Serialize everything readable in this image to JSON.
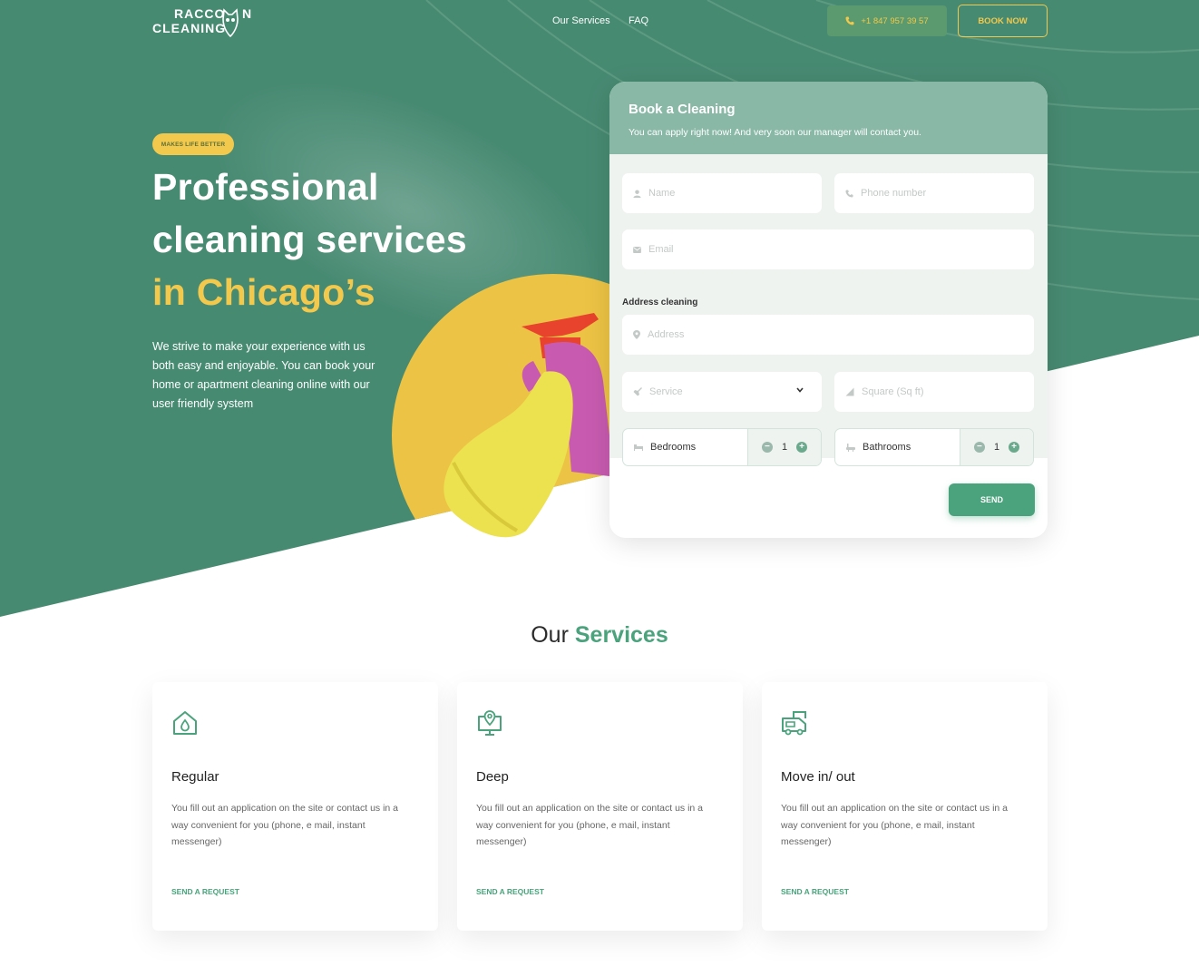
{
  "brand": {
    "line1": "RACCO",
    "line1_end": "N",
    "line2": "CLEANING"
  },
  "nav": {
    "items": [
      "Our Services",
      "FAQ"
    ]
  },
  "header": {
    "phone": "+1 847 957 39 57",
    "book_now": "BOOK NOW"
  },
  "hero": {
    "badge": "MAKES LIFE BETTER",
    "title_line1": "Professional",
    "title_line2": "cleaning services",
    "title_line3": "in Chicago’s",
    "lead_lines": [
      "We strive to make your experience with us",
      "both easy and enjoyable. You can book your",
      "home or apartment cleaning online with our",
      "user friendly system"
    ]
  },
  "booking": {
    "title": "Book a Cleaning",
    "subtitle": "You can apply right now! And very soon our manager will contact you.",
    "name_placeholder": "Name",
    "phone_placeholder": "Phone number",
    "email_placeholder": "Email",
    "address_label": "Address cleaning",
    "address_placeholder": "Address",
    "service_placeholder": "Service",
    "square_placeholder": "Square (Sq ft)",
    "bedrooms": {
      "label": "Bedrooms",
      "value": "1"
    },
    "bathrooms": {
      "label": "Bathrooms",
      "value": "1"
    },
    "send": "SEND"
  },
  "services": {
    "title_plain": "Our",
    "title_accent": "Services",
    "cards": [
      {
        "title": "Regular",
        "icon": "home-drop-icon",
        "desc_lines": [
          "You fill out an application on the site or contact us in a",
          "way convenient for you (phone, e mail, instant",
          "messenger)"
        ],
        "link": "SEND A REQUEST"
      },
      {
        "title": "Deep",
        "icon": "map-pin-board-icon",
        "desc_lines": [
          "You fill out an application on the site or contact us in a",
          "way convenient for you (phone, e mail, instant",
          "messenger)"
        ],
        "link": "SEND A REQUEST"
      },
      {
        "title": "Move in/ out",
        "icon": "moving-truck-icon",
        "desc_lines": [
          "You fill out an application on the site or contact us in a",
          "way convenient for you (phone, e mail, instant",
          "messenger)"
        ],
        "link": "SEND A REQUEST"
      }
    ]
  },
  "colors": {
    "green": "#478a72",
    "accent_green": "#4aa37c",
    "yellow": "#f2c94c"
  }
}
